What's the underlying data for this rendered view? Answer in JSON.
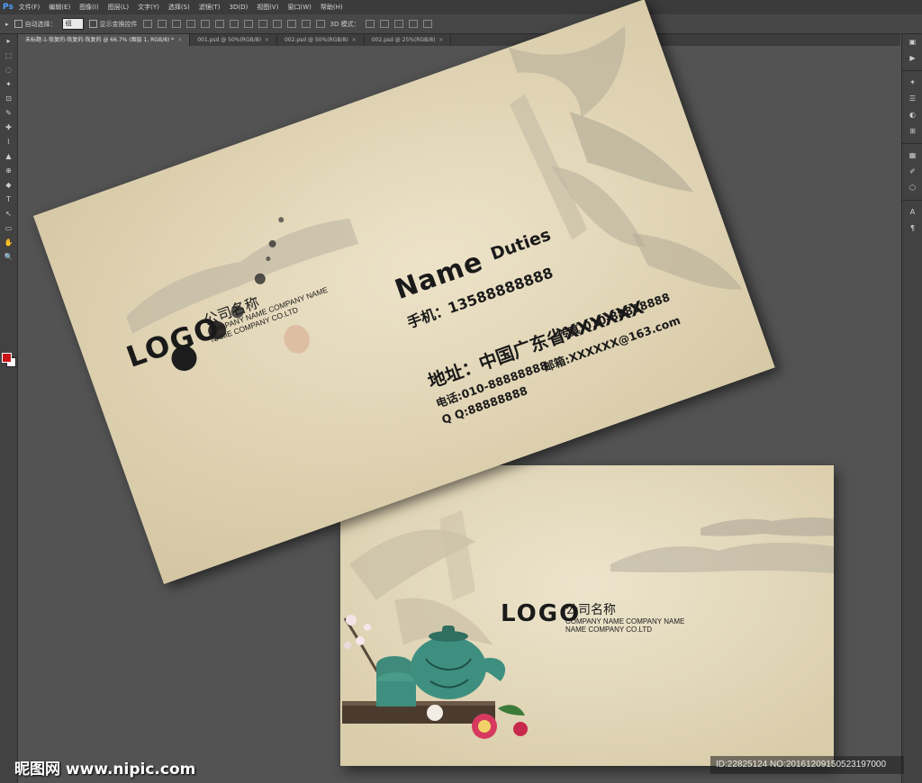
{
  "app": {
    "logo": "Ps",
    "menu": [
      "文件(F)",
      "编辑(E)",
      "图像(I)",
      "图层(L)",
      "文字(Y)",
      "选择(S)",
      "滤镜(T)",
      "3D(D)",
      "视图(V)",
      "窗口(W)",
      "帮助(H)"
    ],
    "options": {
      "auto_select_label": "自动选择：",
      "auto_select_value": "组",
      "show_transform_label": "显示变换控件",
      "mode_3d_label": "3D 模式："
    },
    "tabs": [
      {
        "label": "未标题-1-恢复的-恢复的-恢复的 @ 66.7% (图层 1, RGB/8) *",
        "active": true
      },
      {
        "label": "001.psd @ 50%(RGB/8)",
        "active": false
      },
      {
        "label": "002.psd @ 50%(RGB/8)",
        "active": false
      },
      {
        "label": "002.psd @ 25%(RGB/8)",
        "active": false
      }
    ],
    "close_glyph": "×",
    "tools": [
      "▸",
      "⬚",
      "◌",
      "✦",
      "⊡",
      "✎",
      "✚",
      "⌇",
      "▲",
      "⊕",
      "◆",
      "T",
      "↖",
      "▭",
      "✋",
      "🔍"
    ],
    "right_tools": [
      "▣",
      "▶",
      "✶",
      "☰",
      "◐",
      "⊞",
      "▦",
      "✐",
      "⬡",
      "A",
      "¶"
    ],
    "foreground_color": "#c8141b",
    "background_color": "#ffffff"
  },
  "front_card": {
    "logo": "LOGO",
    "company_cn": "公司名称",
    "company_en_1": "COMPANY NAME COMPANY NAME",
    "company_en_2": "NAME COMPANY CO.LTD",
    "name": "Name",
    "duties": "Duties",
    "mobile": "手机：13588888888",
    "address": "地址：中国广东省XXXXXX",
    "fax": "传真:010-88888888",
    "phone": "电话:010-88888888",
    "email": "邮箱:XXXXXX@163.com",
    "qq": "Q Q:88888888"
  },
  "back_card": {
    "logo": "LOGO",
    "company_cn": "公司名称",
    "company_en_1": "COMPANY NAME COMPANY NAME",
    "company_en_2": "NAME COMPANY CO.LTD"
  },
  "watermark": {
    "left": "昵图网 www.nipic.com",
    "right": "ID:22825124 NO:20161209150523197000"
  },
  "colors": {
    "canvas": "#535353",
    "card_paper": "#e7dcc0",
    "ink": "#1a1a1a",
    "qipao_blue": "#1e3a7a",
    "teapot_jade": "#3e8f80"
  }
}
